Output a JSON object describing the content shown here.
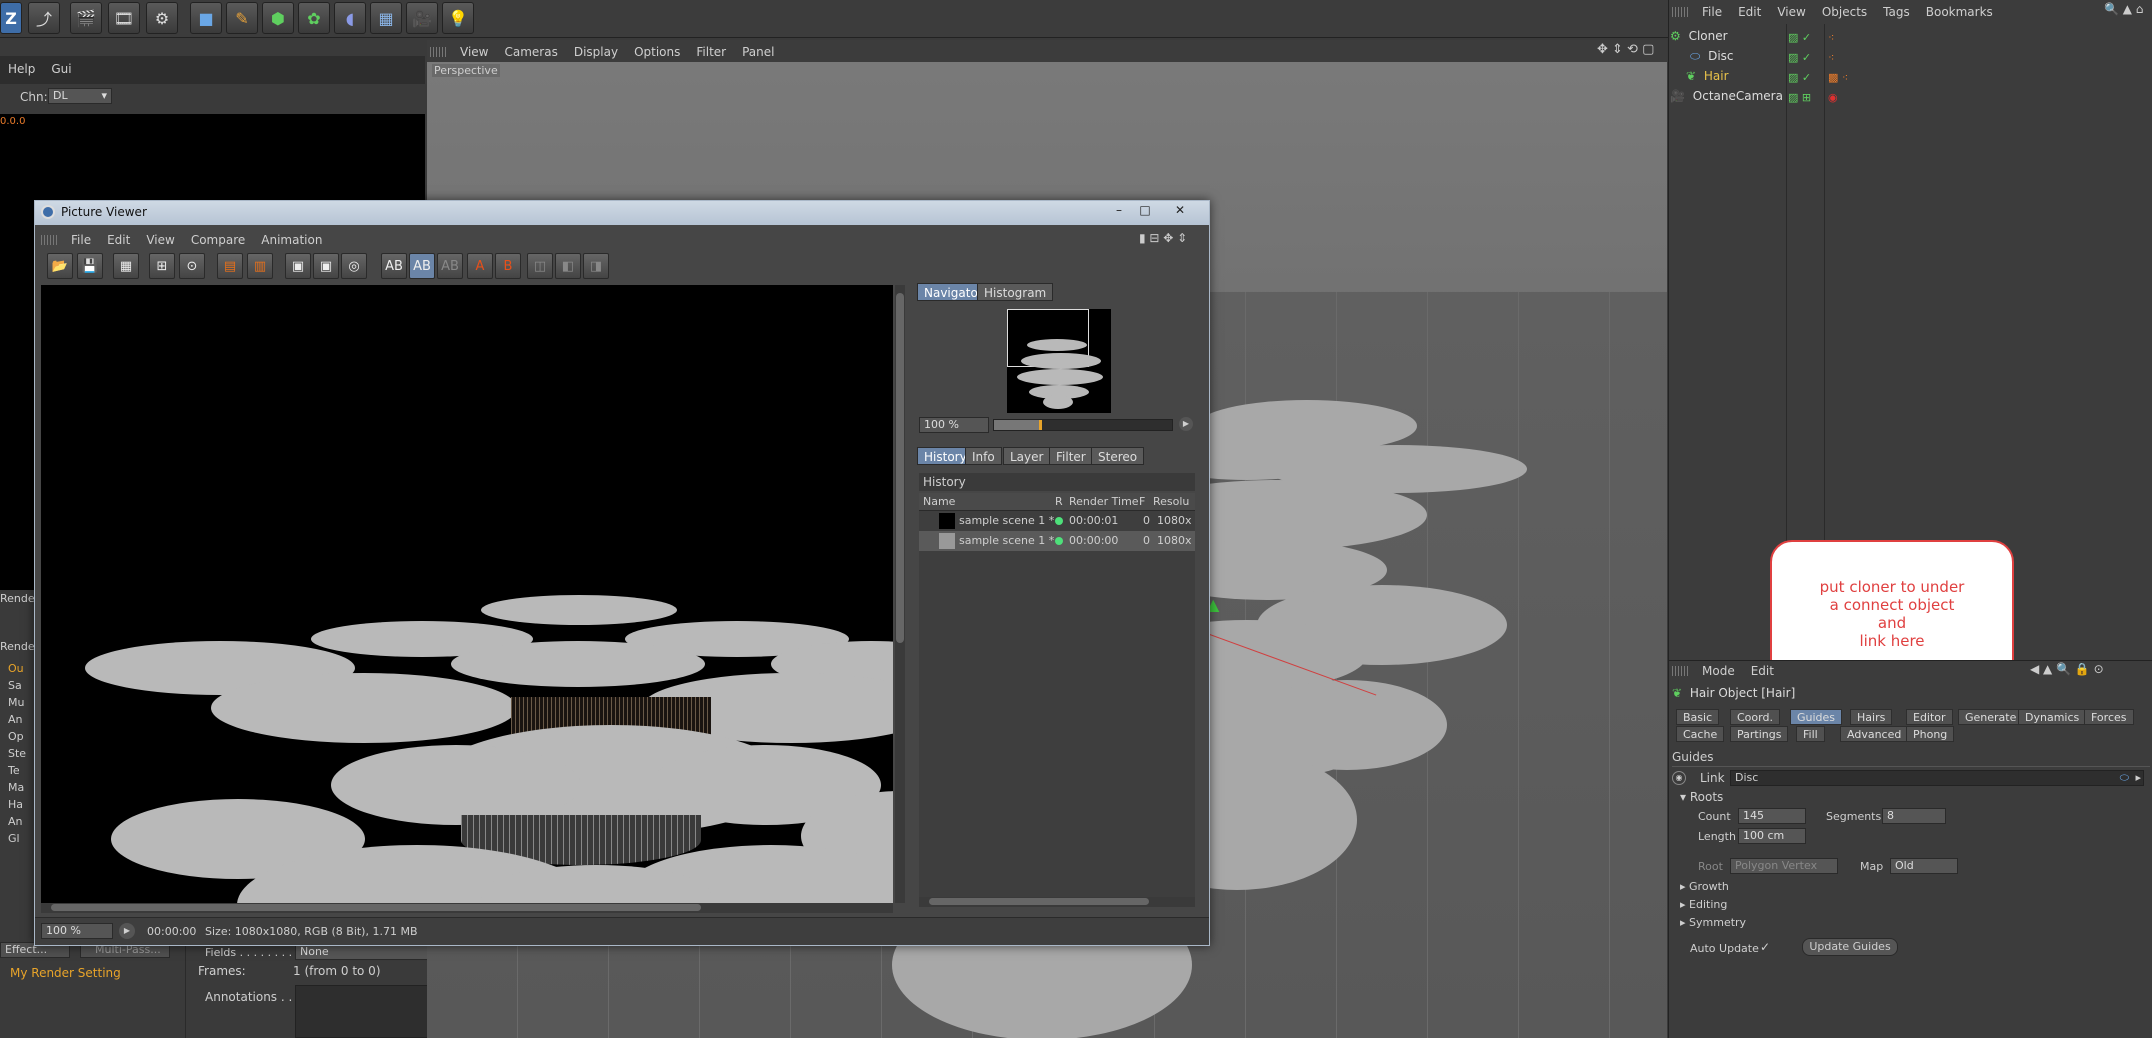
{
  "toolbar": {
    "icons": [
      "cinema4d-logo-icon",
      "undo-icon",
      "render-view-icon",
      "render-picture-viewer-icon",
      "render-settings-icon",
      "cube-icon",
      "pen-icon",
      "nurbs-icon",
      "array-icon",
      "deformer-icon",
      "floor-icon",
      "camera-icon",
      "light-icon"
    ]
  },
  "left_panel": {
    "menu": [
      "Help",
      "Gui"
    ],
    "chn_label": "Chn:",
    "chn_value": "DL",
    "value_readout": "0.0.0",
    "render_list_header": "Rende",
    "render_tree_header": "Rende",
    "render_tree_items": [
      "Ou",
      "Sa",
      "Mu",
      "An",
      "Op",
      "Ste",
      "Te",
      "Ma",
      "Ha",
      "An",
      "Gl"
    ],
    "effects_button": "Effect...",
    "multipass_button": "Multi-Pass...",
    "my_render_setting": "My Render Setting",
    "fields_label": "Fields . . . . . . . . .",
    "fields_value": "None",
    "frames_label": "Frames:",
    "frames_value": "1 (from 0 to 0)",
    "annotations_label": "Annotations . . ."
  },
  "viewport": {
    "menu": [
      "View",
      "Cameras",
      "Display",
      "Options",
      "Filter",
      "Panel"
    ],
    "label": "Perspective"
  },
  "picture_viewer": {
    "title": "Picture Viewer",
    "menu": [
      "File",
      "Edit",
      "View",
      "Compare",
      "Animation"
    ],
    "nav_tabs": [
      "Navigator",
      "Histogram"
    ],
    "zoom": "100 %",
    "info_tabs": [
      "History",
      "Info",
      "Layer",
      "Filter",
      "Stereo"
    ],
    "history_header": "History",
    "columns": [
      "Name",
      "R",
      "Render Time",
      "F",
      "Resolu"
    ],
    "rows": [
      {
        "name": "sample scene 1 *",
        "time": "00:00:01",
        "f": "0",
        "res": "1080x"
      },
      {
        "name": "sample scene 1 *",
        "time": "00:00:00",
        "f": "0",
        "res": "1080x"
      }
    ],
    "status_zoom": "100 %",
    "status_time": "00:00:00",
    "status_size": "Size: 1080x1080, RGB (8 Bit), 1.71 MB"
  },
  "object_manager": {
    "menu": [
      "File",
      "Edit",
      "View",
      "Objects",
      "Tags",
      "Bookmarks"
    ],
    "objects": [
      {
        "name": "Cloner",
        "indent": 0,
        "color": "#dddddd"
      },
      {
        "name": "Disc",
        "indent": 1,
        "color": "#dddddd"
      },
      {
        "name": "Hair",
        "indent": 1,
        "color": "#e8c24a"
      },
      {
        "name": "OctaneCamera",
        "indent": 0,
        "color": "#dddddd"
      }
    ]
  },
  "callout": {
    "lines": [
      "put cloner to under",
      "a connect object",
      "and",
      "link here"
    ],
    "color": "#e04040"
  },
  "attributes": {
    "menu": [
      "Mode",
      "Edit"
    ],
    "object_title": "Hair Object [Hair]",
    "tabs_row1": [
      "Basic",
      "Coord.",
      "Guides",
      "Hairs",
      "Editor",
      "Generate",
      "Dynamics",
      "Forces"
    ],
    "tabs_row2": [
      "Cache",
      "Partings",
      "Fill",
      "Advanced",
      "Phong"
    ],
    "section": "Guides",
    "link_label": "Link",
    "link_value": "Disc",
    "roots_label": "Roots",
    "count_label": "Count",
    "count_value": "145",
    "segments_label": "Segments",
    "segments_value": "8",
    "length_label": "Length",
    "length_value": "100 cm",
    "root_label": "Root",
    "root_value": "Polygon Vertex",
    "map_label": "Map",
    "map_value": "Old",
    "collapsed": [
      "Growth",
      "Editing",
      "Symmetry"
    ],
    "auto_update_label": "Auto Update",
    "update_guides": "Update Guides"
  }
}
